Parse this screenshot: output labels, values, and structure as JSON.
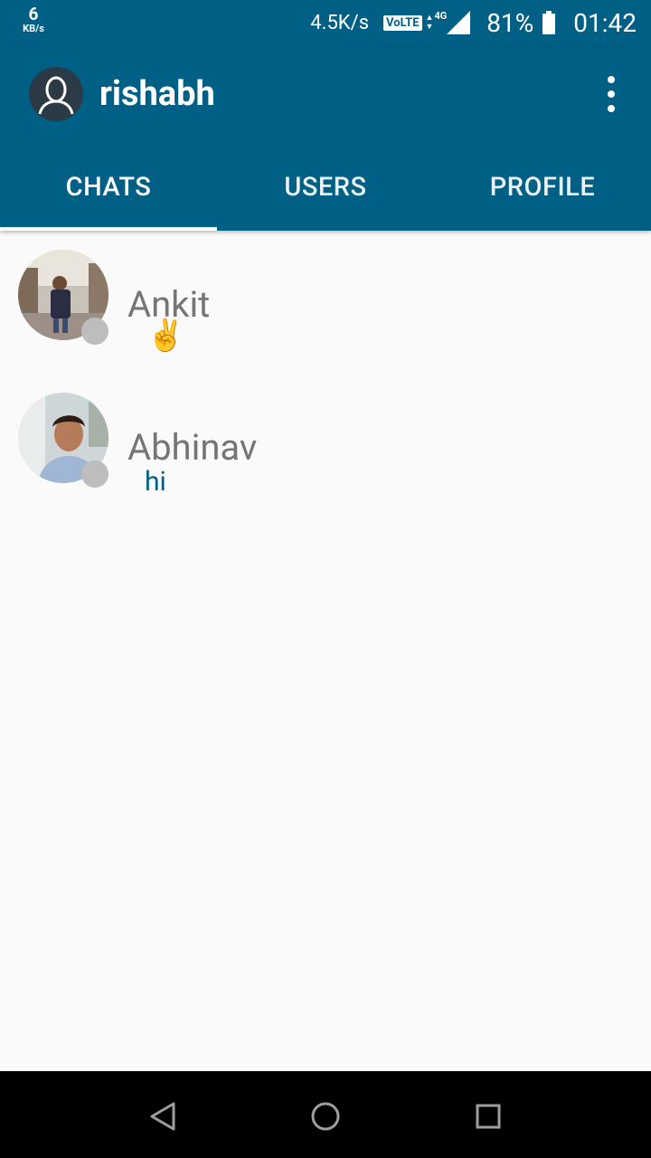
{
  "status_bar": {
    "data_speed_value": "6",
    "data_speed_unit": "KB/s",
    "network_speed": "4.5K/s",
    "volte_label": "VoLTE",
    "network_type": "4G",
    "battery_percent": "81%",
    "time": "01:42"
  },
  "app_bar": {
    "username": "rishabh",
    "self_avatar_icon": "person-outline-icon",
    "menu_icon": "more-vert-icon",
    "tabs": [
      {
        "label": "CHATS",
        "selected": true
      },
      {
        "label": "USERS",
        "selected": false
      },
      {
        "label": "PROFILE",
        "selected": false
      }
    ]
  },
  "chats": [
    {
      "name": "Ankit",
      "last_message": "✌️",
      "presence": "offline"
    },
    {
      "name": "Abhinav",
      "last_message": "hi",
      "presence": "offline"
    }
  ],
  "nav_bar": {
    "back_icon": "triangle-back-icon",
    "home_icon": "circle-home-icon",
    "recents_icon": "square-recents-icon"
  },
  "colors": {
    "primary": "#005f85",
    "background": "#fafafa",
    "presence_offline": "#bdbdbd",
    "name_text": "#757575"
  }
}
